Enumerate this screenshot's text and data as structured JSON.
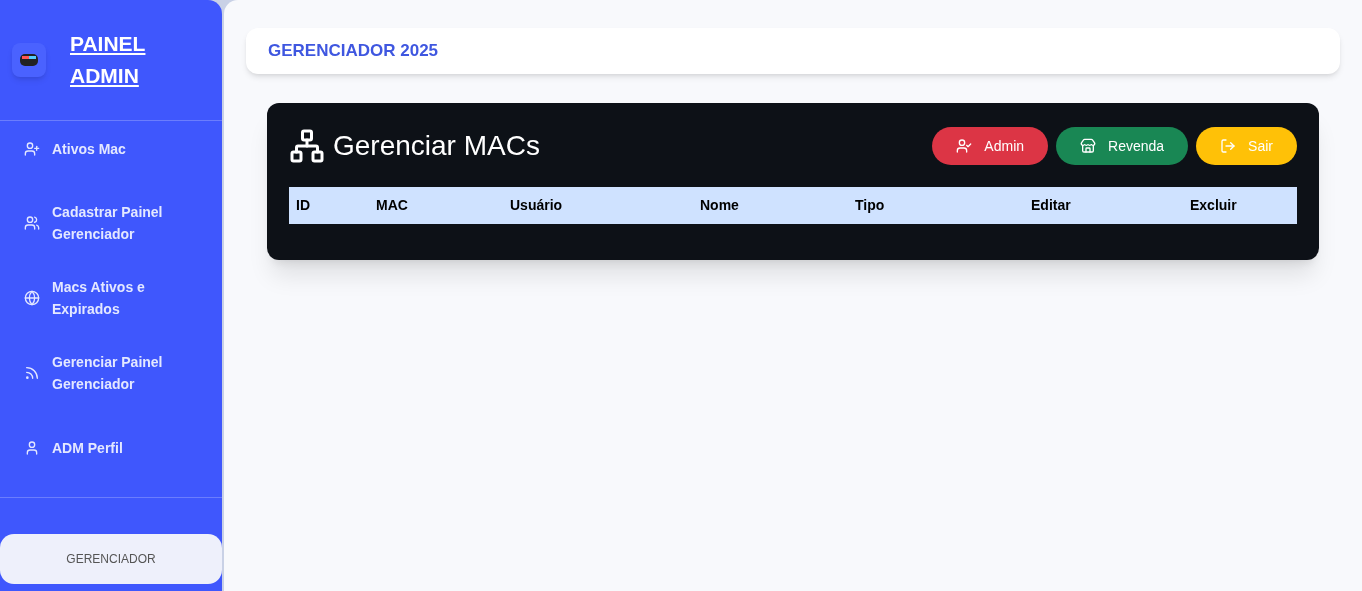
{
  "sidebar": {
    "title_lines": [
      "PAINEL",
      "ADMIN"
    ],
    "items": [
      {
        "label": "Ativos Mac"
      },
      {
        "label": "Cadastrar Painel Gerenciador"
      },
      {
        "label": "Macs Ativos e Expirados"
      },
      {
        "label": "Gerenciar Painel Gerenciador"
      },
      {
        "label": "ADM Perfil"
      }
    ],
    "footer_button": "GERENCIADOR"
  },
  "header": {
    "title": "GERENCIADOR 2025"
  },
  "panel": {
    "title": "Gerenciar MACs",
    "buttons": [
      {
        "label": "Admin",
        "color": "#dc3545"
      },
      {
        "label": "Revenda",
        "color": "#198754"
      },
      {
        "label": "Sair",
        "color": "#ffc107"
      }
    ],
    "table": {
      "columns": [
        "ID",
        "MAC",
        "Usuário",
        "Nome",
        "Tipo",
        "Editar",
        "Excluir"
      ]
    }
  }
}
